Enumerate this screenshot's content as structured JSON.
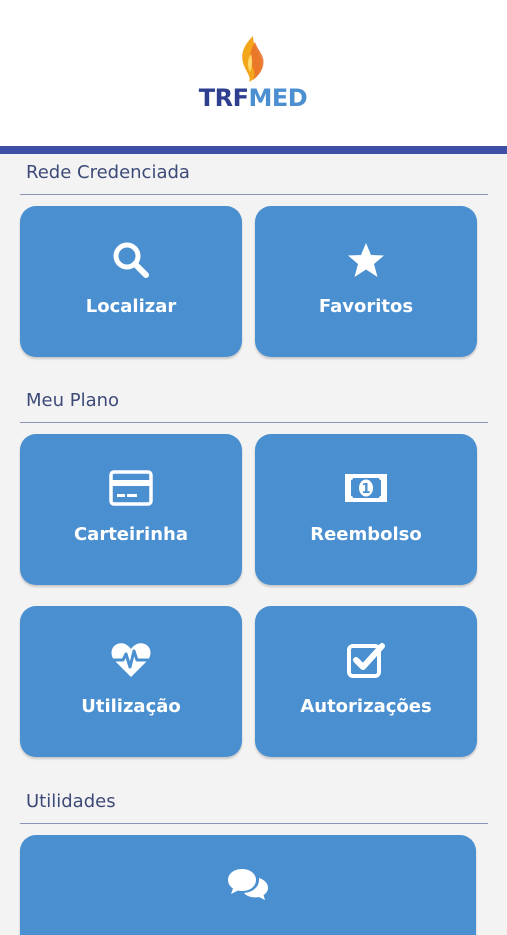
{
  "app": {
    "logo_left": "TRF",
    "logo_right": "MED"
  },
  "colors": {
    "accent": "#3f4fa6",
    "tile": "#4a8fd0",
    "section_text": "#3d4a78"
  },
  "sections": [
    {
      "title": "Rede Credenciada",
      "tiles": [
        {
          "label": "Localizar",
          "icon": "search-icon"
        },
        {
          "label": "Favoritos",
          "icon": "star-icon"
        }
      ]
    },
    {
      "title": "Meu Plano",
      "tiles": [
        {
          "label": "Carteirinha",
          "icon": "card-icon"
        },
        {
          "label": "Reembolso",
          "icon": "money-icon"
        },
        {
          "label": "Utilização",
          "icon": "heartbeat-icon"
        },
        {
          "label": "Autorizações",
          "icon": "checkbox-icon"
        }
      ]
    },
    {
      "title": "Utilidades",
      "tiles": [
        {
          "label": "",
          "icon": "chat-icon"
        }
      ]
    }
  ]
}
